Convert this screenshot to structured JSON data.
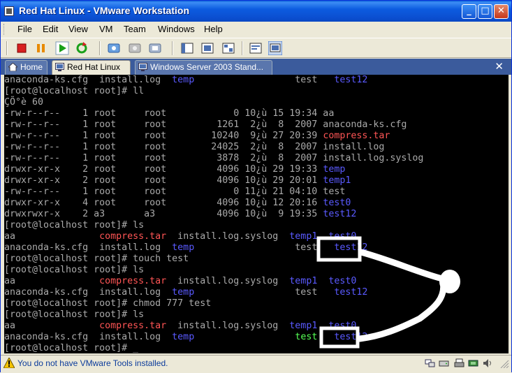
{
  "window": {
    "title": "Red Hat Linux - VMware Workstation",
    "controls": {
      "minimize": "_",
      "maximize": "□",
      "close": "✕"
    }
  },
  "menu": [
    "File",
    "Edit",
    "View",
    "VM",
    "Team",
    "Windows",
    "Help"
  ],
  "toolbar": {
    "buttons": [
      "power-off",
      "suspend",
      "power-on",
      "reset",
      "snapshot",
      "revert-snapshot",
      "snapshot-manager",
      "quick-switch",
      "full-screen",
      "unity",
      "summary-view",
      "console-view"
    ]
  },
  "tabs": [
    {
      "label": "Home",
      "icon": "home-icon",
      "active": false
    },
    {
      "label": "Red Hat Linux",
      "icon": "vm-icon",
      "active": true
    },
    {
      "label": "Windows Server 2003 Stand...",
      "icon": "vm-icon",
      "active": false
    }
  ],
  "tab_close": "✕",
  "terminal": {
    "colors": {
      "background": "#000000",
      "text": "#aaaaaa",
      "directory": "#5a5aff",
      "archive": "#ff5555",
      "executable": "#55ff55"
    },
    "lines": [
      [
        {
          "t": "anaconda-ks.cfg  install.log  "
        },
        {
          "t": "temp",
          "c": "blue"
        },
        {
          "t": "                  test   "
        },
        {
          "t": "test12",
          "c": "blue"
        }
      ],
      [
        {
          "t": "[root@localhost root]# ll"
        }
      ],
      [
        {
          "t": "ÇÕ°è 60"
        }
      ],
      [
        {
          "t": "-rw-r--r--    1 root     root            0 10¿ù 15 19:34 aa"
        }
      ],
      [
        {
          "t": "-rw-r--r--    1 root     root         1261  2¿ù  8  2007 anaconda-ks.cfg"
        }
      ],
      [
        {
          "t": "-rw-r--r--    1 root     root        10240  9¿ù 27 20:39 "
        },
        {
          "t": "compress.tar",
          "c": "red"
        }
      ],
      [
        {
          "t": "-rw-r--r--    1 root     root        24025  2¿ù  8  2007 install.log"
        }
      ],
      [
        {
          "t": "-rw-r--r--    1 root     root         3878  2¿ù  8  2007 install.log.syslog"
        }
      ],
      [
        {
          "t": "drwxr-xr-x    2 root     root         4096 10¿ù 29 19:33 "
        },
        {
          "t": "temp",
          "c": "blue"
        }
      ],
      [
        {
          "t": "drwxr-xr-x    2 root     root         4096 10¿ù 29 20:01 "
        },
        {
          "t": "temp1",
          "c": "blue"
        }
      ],
      [
        {
          "t": "-rw-r--r--    1 root     root            0 11¿ù 21 04:10 test"
        }
      ],
      [
        {
          "t": "drwxr-xr-x    4 root     root         4096 10¿ù 12 20:16 "
        },
        {
          "t": "test0",
          "c": "blue"
        }
      ],
      [
        {
          "t": "drwxrwxr-x    2 a3       a3           4096 10¿ù  9 19:35 "
        },
        {
          "t": "test12",
          "c": "blue"
        }
      ],
      [
        {
          "t": "[root@localhost root]# ls"
        }
      ],
      [
        {
          "t": "aa               "
        },
        {
          "t": "compress.tar",
          "c": "red"
        },
        {
          "t": "  install.log.syslog  "
        },
        {
          "t": "temp1",
          "c": "blue"
        },
        {
          "t": "  "
        },
        {
          "t": "test0",
          "c": "blue"
        }
      ],
      [
        {
          "t": "anaconda-ks.cfg  install.log  "
        },
        {
          "t": "temp",
          "c": "blue"
        },
        {
          "t": "                  test   "
        },
        {
          "t": "test12",
          "c": "blue"
        }
      ],
      [
        {
          "t": "[root@localhost root]# touch test"
        }
      ],
      [
        {
          "t": "[root@localhost root]# ls"
        }
      ],
      [
        {
          "t": "aa               "
        },
        {
          "t": "compress.tar",
          "c": "red"
        },
        {
          "t": "  install.log.syslog  "
        },
        {
          "t": "temp1",
          "c": "blue"
        },
        {
          "t": "  "
        },
        {
          "t": "test0",
          "c": "blue"
        }
      ],
      [
        {
          "t": "anaconda-ks.cfg  install.log  "
        },
        {
          "t": "temp",
          "c": "blue"
        },
        {
          "t": "                  test   "
        },
        {
          "t": "test12",
          "c": "blue"
        }
      ],
      [
        {
          "t": "[root@localhost root]# chmod 777 test"
        }
      ],
      [
        {
          "t": "[root@localhost root]# ls"
        }
      ],
      [
        {
          "t": "aa               "
        },
        {
          "t": "compress.tar",
          "c": "red"
        },
        {
          "t": "  install.log.syslog  "
        },
        {
          "t": "temp1",
          "c": "blue"
        },
        {
          "t": "  "
        },
        {
          "t": "test0",
          "c": "blue"
        }
      ],
      [
        {
          "t": "anaconda-ks.cfg  install.log  "
        },
        {
          "t": "temp",
          "c": "blue"
        },
        {
          "t": "                  "
        },
        {
          "t": "test",
          "c": "green"
        },
        {
          "t": "   "
        },
        {
          "t": "test12",
          "c": "blue"
        }
      ],
      [
        {
          "t": "[root@localhost root]# _"
        }
      ]
    ]
  },
  "status": {
    "message": "You do not have VMware Tools installed.",
    "icons": [
      "network-icon",
      "hard-disk-icon",
      "printer-icon",
      "usb-icon",
      "sound-icon"
    ]
  }
}
